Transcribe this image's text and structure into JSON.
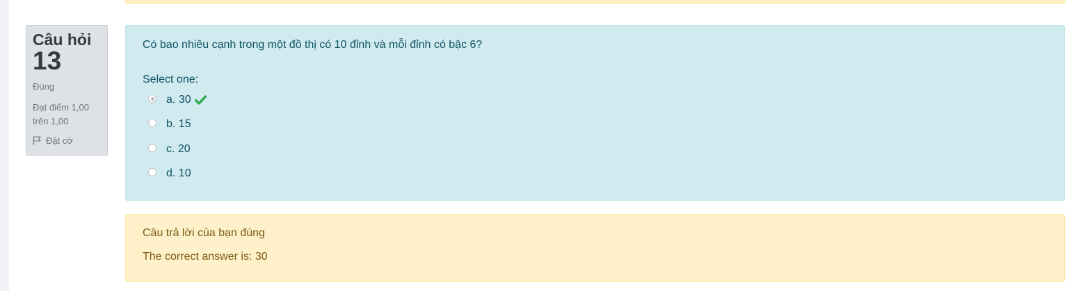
{
  "question": {
    "label": "Câu hỏi",
    "number": "13",
    "state": "Đúng",
    "grade": "Đạt điểm 1,00 trên 1,00",
    "flag_label": "Đặt cờ",
    "text": "Có bao nhiêu cạnh trong một đồ thị có 10 đỉnh và mỗi đỉnh có bậc 6?",
    "prompt": "Select one:",
    "options": [
      {
        "label": "a. 30",
        "selected": true,
        "correct": true
      },
      {
        "label": "b. 15",
        "selected": false,
        "correct": false
      },
      {
        "label": "c. 20",
        "selected": false,
        "correct": false
      },
      {
        "label": "d. 10",
        "selected": false,
        "correct": false
      }
    ]
  },
  "feedback": {
    "specific": "Câu trả lời của bạn đúng",
    "right_answer": "The correct answer is: 30"
  },
  "icons": {
    "flag": "flag-icon",
    "check": "check-icon"
  },
  "colors": {
    "info_bg": "#dee2e6",
    "formulation_bg": "#d0eaef",
    "feedback_bg": "#fef1c9",
    "correct_check": "#28a745"
  }
}
